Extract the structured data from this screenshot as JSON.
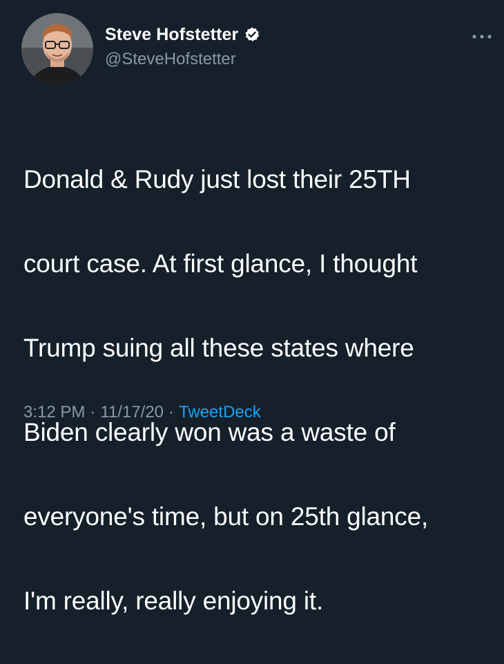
{
  "user": {
    "display_name": "Steve Hofstetter",
    "handle": "@SteveHofstetter",
    "verified": true
  },
  "tweet": {
    "text_lines": [
      "Donald & Rudy just lost their 25TH",
      "court case. At first glance, I thought",
      "Trump suing all these states where",
      "Biden clearly won was a waste of",
      "everyone's time, but on 25th glance,",
      "I'm really, really enjoying it."
    ],
    "time": "3:12 PM",
    "date": "11/17/20",
    "source": "TweetDeck",
    "separator": "·"
  },
  "icons": {
    "verified": "verified-badge-icon",
    "more": "more-options-icon"
  },
  "colors": {
    "background": "#15202b",
    "text": "#ffffff",
    "secondary": "#8899a6",
    "accent": "#1da1f2"
  }
}
